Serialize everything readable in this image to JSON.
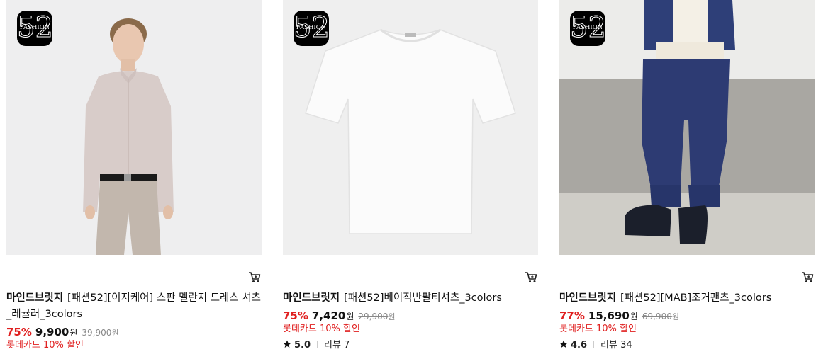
{
  "badge": {
    "number": "52",
    "word": "FASHION"
  },
  "products": [
    {
      "brand": "마인드브릿지",
      "name": "[패션52][이지케어] 스판 멜란지 드레스 셔츠_레귤러_3colors",
      "discount_rate": "75%",
      "price": "9,900",
      "price_unit": "원",
      "original_price": "39,900",
      "original_unit": "원",
      "card_discount": "롯데카드 10% 할인",
      "image_icon": "shirt-model-photo"
    },
    {
      "brand": "마인드브릿지",
      "name": "[패션52]베이직반팔티셔츠_3colors",
      "discount_rate": "75%",
      "price": "7,420",
      "price_unit": "원",
      "original_price": "29,900",
      "original_unit": "원",
      "card_discount": "롯데카드 10% 할인",
      "rating": "5.0",
      "review_label": "리뷰 7",
      "image_icon": "white-tshirt-photo"
    },
    {
      "brand": "마인드브릿지",
      "name": "[패션52][MAB]조거팬츠_3colors",
      "discount_rate": "77%",
      "price": "15,690",
      "price_unit": "원",
      "original_price": "69,900",
      "original_unit": "원",
      "card_discount": "롯데카드 10% 할인",
      "rating": "4.6",
      "review_label": "리뷰 34",
      "image_icon": "jogger-pants-photo"
    }
  ],
  "colors": {
    "sale_red": "#e02020",
    "text": "#111111",
    "muted": "#888888"
  }
}
